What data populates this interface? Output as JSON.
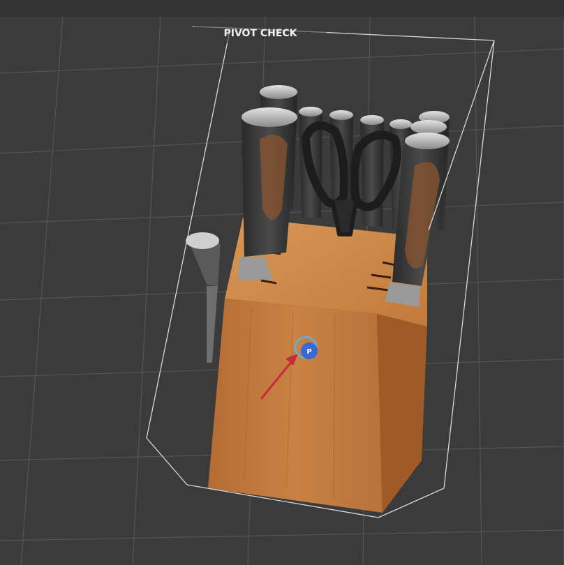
{
  "viewport": {
    "title": "PIVOT CHECK",
    "pivot_label": "P"
  },
  "colors": {
    "background": "#3b3b3b",
    "grid": "#555555",
    "bbox_wire": "#d8d8d8",
    "pivot_fill": "#3a67d6",
    "pivot_ring": "#4fb8e8",
    "arrow": "#c62b3a",
    "wood": "#c27a3c"
  },
  "icons": {
    "pivot": "pivot-gizmo-icon",
    "pointer": "red-arrow-icon"
  }
}
